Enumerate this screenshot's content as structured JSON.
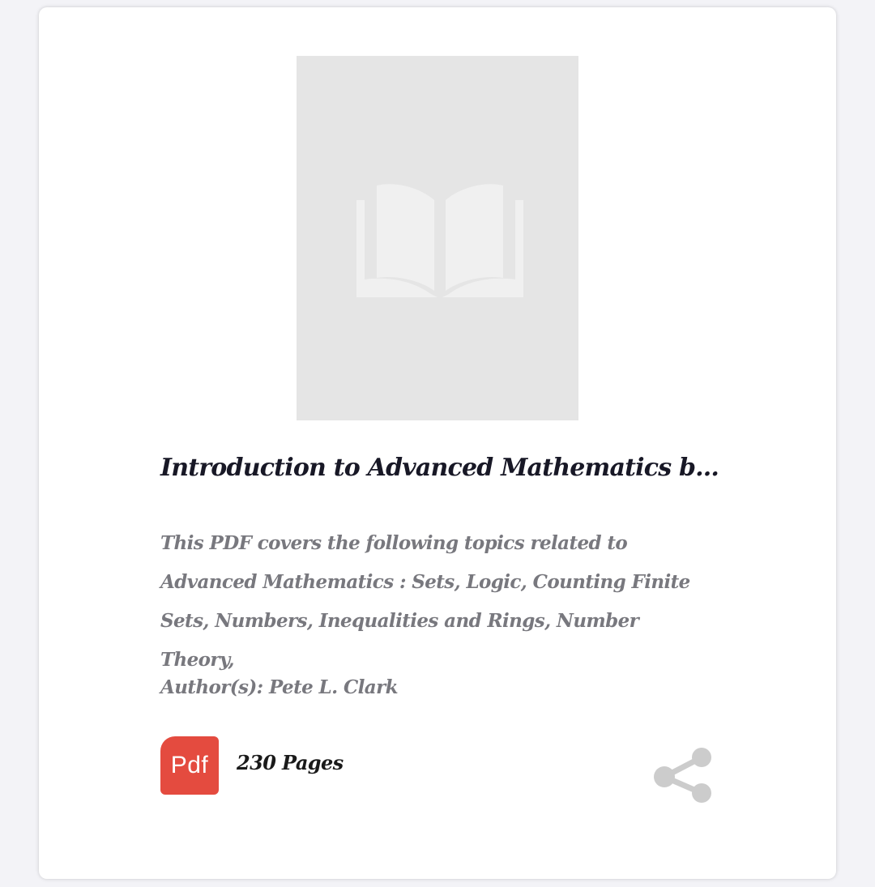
{
  "book": {
    "title": "Introduction to Advanced Mathematics b...",
    "description": "This PDF covers the following topics related to Advanced Mathematics : Sets, Logic, Counting Finite Sets, Numbers, Inequalities and Rings, Number Theory,",
    "author": "Author(s): Pete L. Clark",
    "pages": "230 Pages",
    "format_label": "Pdf",
    "cover_icon": "open-book-icon"
  },
  "actions": {
    "share_icon": "share-icon"
  },
  "colors": {
    "pdf_badge": "#e44b3f",
    "cover_bg": "#e5e5e5",
    "title": "#181826",
    "muted_text": "#78787e",
    "icon_gray": "#cccccc"
  }
}
